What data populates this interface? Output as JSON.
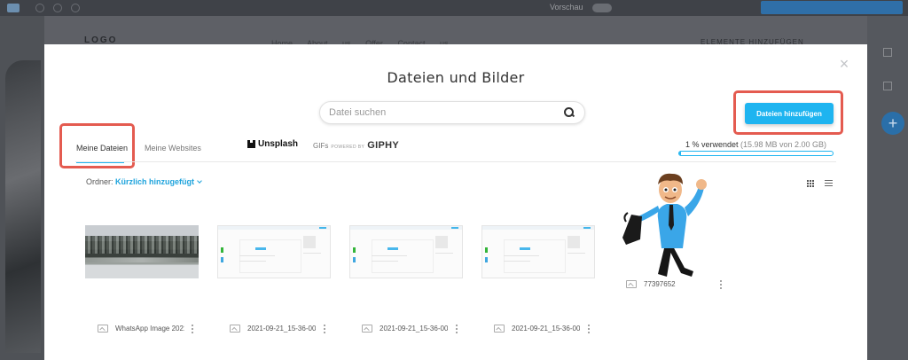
{
  "background": {
    "preview_label": "Vorschau",
    "logo_text": "LOGO",
    "nav_items": [
      "Home",
      "About us",
      "Offer",
      "Contact us"
    ],
    "panel_title": "ELEMENTE HINZUFÜGEN"
  },
  "modal": {
    "title": "Dateien und Bilder",
    "search_placeholder": "Datei suchen",
    "add_files_label": "Dateien hinzufügen",
    "tabs": {
      "my_files": "Meine Dateien",
      "my_websites": "Meine Websites",
      "unsplash": "Unsplash",
      "gifs": "GIFs",
      "powered_by": "POWERED BY",
      "giphy": "GIPHY"
    },
    "usage": {
      "summary": "1 % verwendet",
      "detail": "(15.98 MB von 2.00 GB)",
      "percent": 1
    },
    "folder": {
      "label": "Ordner:",
      "value": "Kürzlich hinzugefügt"
    },
    "files": [
      {
        "name": "WhatsApp Image 2021...",
        "type": "winter-photo"
      },
      {
        "name": "2021-09-21_15-36-00",
        "type": "screenshot"
      },
      {
        "name": "2021-09-21_15-36-00",
        "type": "screenshot"
      },
      {
        "name": "2021-09-21_15-36-00",
        "type": "screenshot"
      },
      {
        "name": "77397652",
        "type": "cartoon-businessman"
      }
    ]
  },
  "colors": {
    "accent": "#1eb4f0",
    "highlight": "#e45b50",
    "overlay": "#5e6066"
  }
}
